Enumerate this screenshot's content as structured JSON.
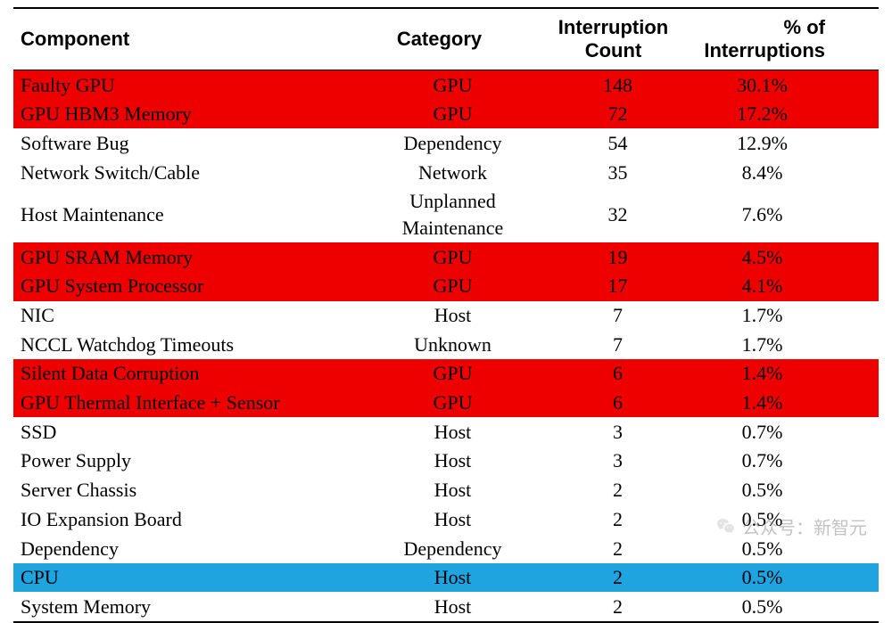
{
  "chart_data": {
    "type": "table",
    "title": "",
    "columns": [
      "Component",
      "Category",
      "Interruption Count",
      "% of Interruptions"
    ],
    "rows": [
      {
        "component": "Faulty GPU",
        "category": "GPU",
        "count": 148,
        "pct": "30.1%",
        "highlight": "red"
      },
      {
        "component": "GPU HBM3 Memory",
        "category": "GPU",
        "count": 72,
        "pct": "17.2%",
        "highlight": "red"
      },
      {
        "component": "Software Bug",
        "category": "Dependency",
        "count": 54,
        "pct": "12.9%",
        "highlight": null
      },
      {
        "component": "Network Switch/Cable",
        "category": "Network",
        "count": 35,
        "pct": "8.4%",
        "highlight": null
      },
      {
        "component": "Host Maintenance",
        "category": "Unplanned Maintenance",
        "count": 32,
        "pct": "7.6%",
        "highlight": null
      },
      {
        "component": "GPU SRAM Memory",
        "category": "GPU",
        "count": 19,
        "pct": "4.5%",
        "highlight": "red"
      },
      {
        "component": "GPU System Processor",
        "category": "GPU",
        "count": 17,
        "pct": "4.1%",
        "highlight": "red"
      },
      {
        "component": "NIC",
        "category": "Host",
        "count": 7,
        "pct": "1.7%",
        "highlight": null
      },
      {
        "component": "NCCL Watchdog Timeouts",
        "category": "Unknown",
        "count": 7,
        "pct": "1.7%",
        "highlight": null
      },
      {
        "component": "Silent Data Corruption",
        "category": "GPU",
        "count": 6,
        "pct": "1.4%",
        "highlight": "red"
      },
      {
        "component": "GPU Thermal Interface + Sensor",
        "category": "GPU",
        "count": 6,
        "pct": "1.4%",
        "highlight": "red"
      },
      {
        "component": "SSD",
        "category": "Host",
        "count": 3,
        "pct": "0.7%",
        "highlight": null
      },
      {
        "component": "Power Supply",
        "category": "Host",
        "count": 3,
        "pct": "0.7%",
        "highlight": null
      },
      {
        "component": "Server Chassis",
        "category": "Host",
        "count": 2,
        "pct": "0.5%",
        "highlight": null
      },
      {
        "component": "IO Expansion Board",
        "category": "Host",
        "count": 2,
        "pct": "0.5%",
        "highlight": null
      },
      {
        "component": "Dependency",
        "category": "Dependency",
        "count": 2,
        "pct": "0.5%",
        "highlight": null
      },
      {
        "component": "CPU",
        "category": "Host",
        "count": 2,
        "pct": "0.5%",
        "highlight": "blue"
      },
      {
        "component": "System Memory",
        "category": "Host",
        "count": 2,
        "pct": "0.5%",
        "highlight": null
      }
    ]
  },
  "headers": {
    "component": "Component",
    "category": "Category",
    "count": "Interruption Count",
    "pct": "% of Interruptions"
  },
  "watermark": {
    "label": "公众号：新智元"
  }
}
